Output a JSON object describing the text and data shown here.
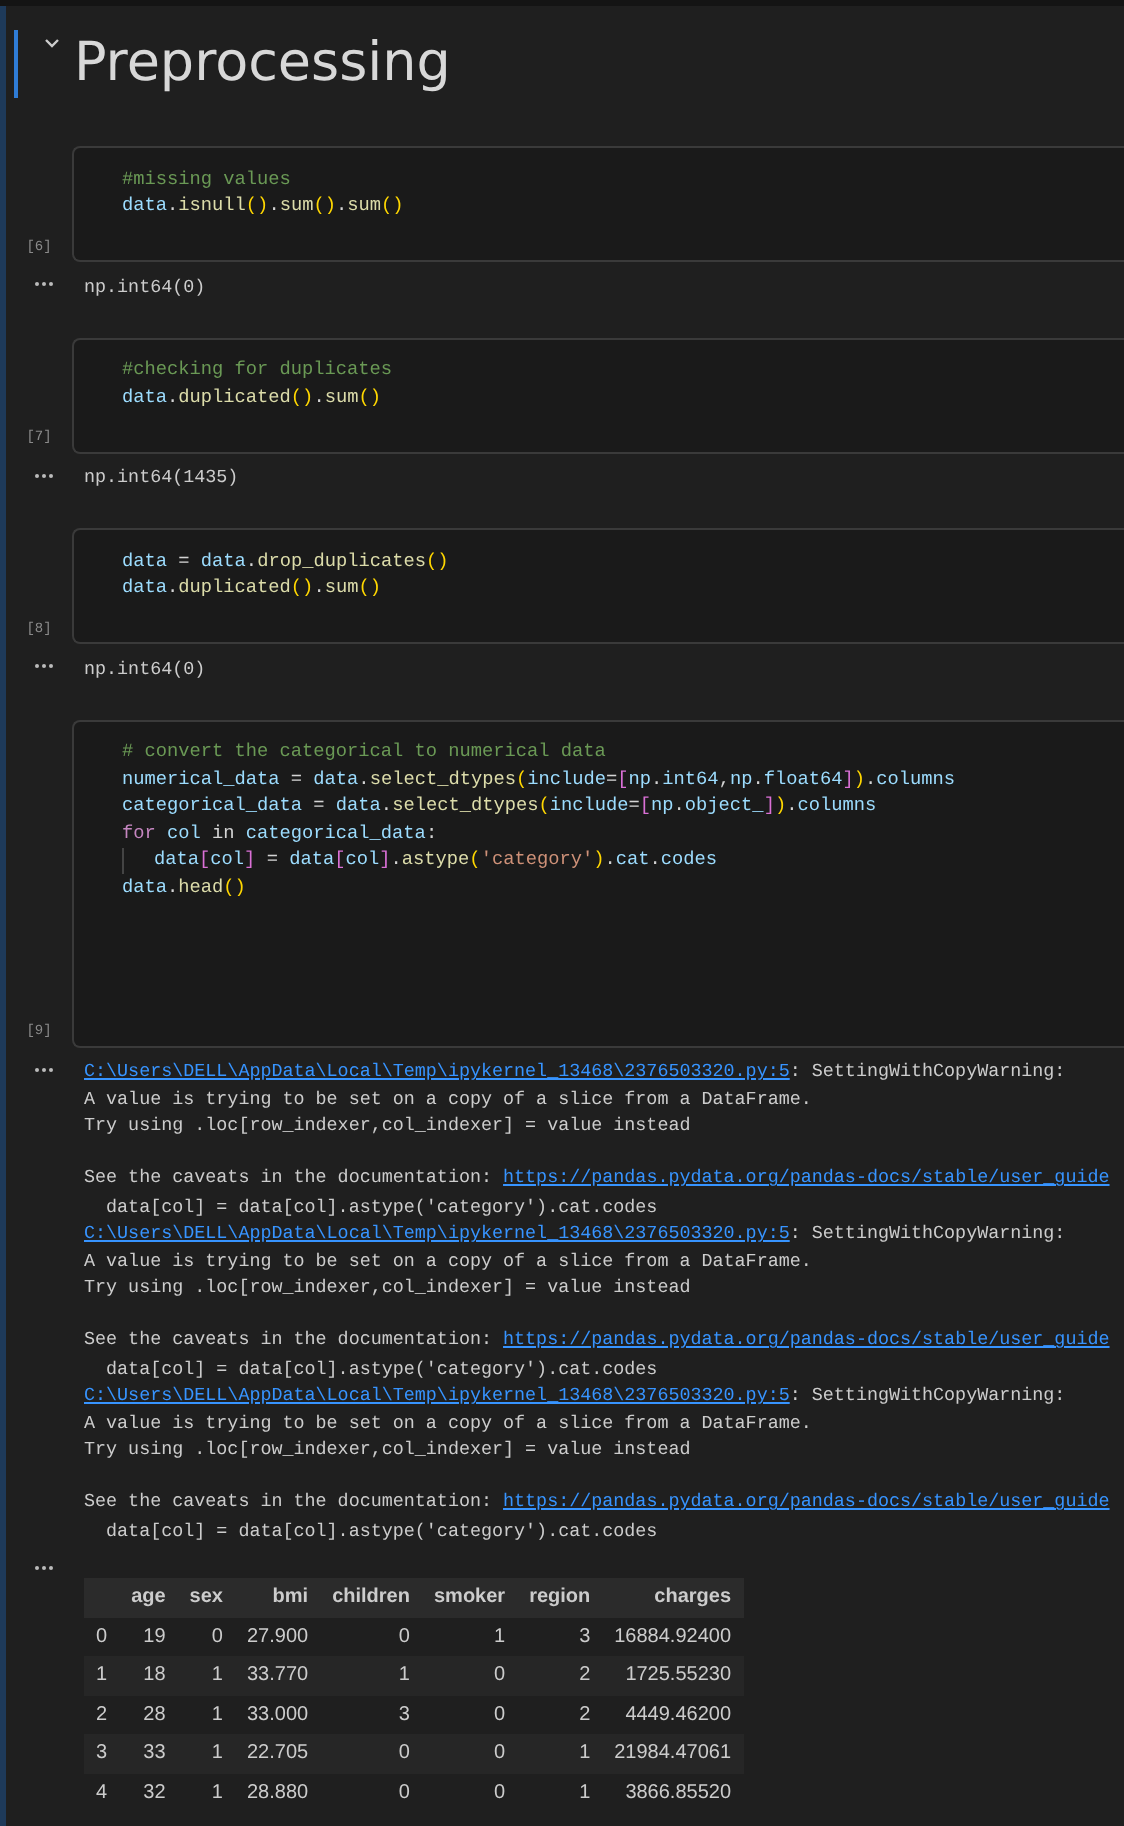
{
  "heading": {
    "title": "Preprocessing",
    "expanded": true,
    "selected": true
  },
  "cells": [
    {
      "count": "[6]",
      "lines": [
        {
          "segments": [
            {
              "kind": "comment",
              "text": "#missing values"
            }
          ]
        },
        {
          "segments": [
            {
              "kind": "var",
              "text": "data"
            },
            {
              "kind": "plain",
              "text": "."
            },
            {
              "kind": "func",
              "text": "isnull"
            },
            {
              "kind": "paren",
              "text": "()"
            },
            {
              "kind": "plain",
              "text": "."
            },
            {
              "kind": "func",
              "text": "sum"
            },
            {
              "kind": "paren",
              "text": "()"
            },
            {
              "kind": "plain",
              "text": "."
            },
            {
              "kind": "func",
              "text": "sum"
            },
            {
              "kind": "paren",
              "text": "()"
            }
          ]
        }
      ],
      "outputs": [
        {
          "kind": "text",
          "lines": [
            {
              "segments": [
                {
                  "kind": "plain",
                  "text": "np.int64(0)"
                }
              ]
            }
          ]
        }
      ]
    },
    {
      "count": "[7]",
      "lines": [
        {
          "segments": [
            {
              "kind": "comment",
              "text": "#checking for duplicates"
            }
          ]
        },
        {
          "segments": [
            {
              "kind": "var",
              "text": "data"
            },
            {
              "kind": "plain",
              "text": "."
            },
            {
              "kind": "func",
              "text": "duplicated"
            },
            {
              "kind": "paren",
              "text": "()"
            },
            {
              "kind": "plain",
              "text": "."
            },
            {
              "kind": "func",
              "text": "sum"
            },
            {
              "kind": "paren",
              "text": "()"
            }
          ]
        }
      ],
      "outputs": [
        {
          "kind": "text",
          "lines": [
            {
              "segments": [
                {
                  "kind": "plain",
                  "text": "np.int64(1435)"
                }
              ]
            }
          ]
        }
      ]
    },
    {
      "count": "[8]",
      "lines": [
        {
          "segments": [
            {
              "kind": "var",
              "text": "data"
            },
            {
              "kind": "plain",
              "text": " = "
            },
            {
              "kind": "var",
              "text": "data"
            },
            {
              "kind": "plain",
              "text": "."
            },
            {
              "kind": "func",
              "text": "drop_duplicates"
            },
            {
              "kind": "paren",
              "text": "()"
            }
          ]
        },
        {
          "segments": [
            {
              "kind": "var",
              "text": "data"
            },
            {
              "kind": "plain",
              "text": "."
            },
            {
              "kind": "func",
              "text": "duplicated"
            },
            {
              "kind": "paren",
              "text": "()"
            },
            {
              "kind": "plain",
              "text": "."
            },
            {
              "kind": "func",
              "text": "sum"
            },
            {
              "kind": "paren",
              "text": "()"
            }
          ]
        }
      ],
      "outputs": [
        {
          "kind": "text",
          "lines": [
            {
              "segments": [
                {
                  "kind": "plain",
                  "text": "np.int64(0)"
                }
              ]
            }
          ]
        }
      ]
    },
    {
      "count": "[9]",
      "lines": [
        {
          "segments": [
            {
              "kind": "comment",
              "text": "# convert the categorical to numerical data"
            }
          ]
        },
        {
          "segments": [
            {
              "kind": "var",
              "text": "numerical_data"
            },
            {
              "kind": "plain",
              "text": " = "
            },
            {
              "kind": "var",
              "text": "data"
            },
            {
              "kind": "plain",
              "text": "."
            },
            {
              "kind": "func",
              "text": "select_dtypes"
            },
            {
              "kind": "paren",
              "text": "("
            },
            {
              "kind": "var",
              "text": "include"
            },
            {
              "kind": "plain",
              "text": "="
            },
            {
              "kind": "bracket",
              "text": "["
            },
            {
              "kind": "var",
              "text": "np"
            },
            {
              "kind": "plain",
              "text": "."
            },
            {
              "kind": "var",
              "text": "int64"
            },
            {
              "kind": "plain",
              "text": ","
            },
            {
              "kind": "var",
              "text": "np"
            },
            {
              "kind": "plain",
              "text": "."
            },
            {
              "kind": "var",
              "text": "float64"
            },
            {
              "kind": "bracket",
              "text": "]"
            },
            {
              "kind": "paren",
              "text": ")"
            },
            {
              "kind": "plain",
              "text": "."
            },
            {
              "kind": "var",
              "text": "columns"
            }
          ]
        },
        {
          "segments": [
            {
              "kind": "var",
              "text": "categorical_data"
            },
            {
              "kind": "plain",
              "text": " = "
            },
            {
              "kind": "var",
              "text": "data"
            },
            {
              "kind": "plain",
              "text": "."
            },
            {
              "kind": "func",
              "text": "select_dtypes"
            },
            {
              "kind": "paren",
              "text": "("
            },
            {
              "kind": "var",
              "text": "include"
            },
            {
              "kind": "plain",
              "text": "="
            },
            {
              "kind": "bracket",
              "text": "["
            },
            {
              "kind": "var",
              "text": "np"
            },
            {
              "kind": "plain",
              "text": "."
            },
            {
              "kind": "var",
              "text": "object_"
            },
            {
              "kind": "bracket",
              "text": "]"
            },
            {
              "kind": "paren",
              "text": ")"
            },
            {
              "kind": "plain",
              "text": "."
            },
            {
              "kind": "var",
              "text": "columns"
            }
          ]
        },
        {
          "segments": [
            {
              "kind": "keyword",
              "text": "for"
            },
            {
              "kind": "var",
              "text": " col"
            },
            {
              "kind": "plain",
              "text": " in "
            },
            {
              "kind": "var",
              "text": "categorical_data"
            },
            {
              "kind": "plain",
              "text": ":"
            }
          ]
        },
        {
          "indented": true,
          "segments": [
            {
              "kind": "var",
              "text": "data"
            },
            {
              "kind": "bracket",
              "text": "["
            },
            {
              "kind": "var",
              "text": "col"
            },
            {
              "kind": "bracket",
              "text": "]"
            },
            {
              "kind": "plain",
              "text": " = "
            },
            {
              "kind": "var",
              "text": "data"
            },
            {
              "kind": "bracket",
              "text": "["
            },
            {
              "kind": "var",
              "text": "col"
            },
            {
              "kind": "bracket",
              "text": "]"
            },
            {
              "kind": "plain",
              "text": "."
            },
            {
              "kind": "func",
              "text": "astype"
            },
            {
              "kind": "paren",
              "text": "("
            },
            {
              "kind": "string",
              "text": "'category'"
            },
            {
              "kind": "paren",
              "text": ")"
            },
            {
              "kind": "plain",
              "text": "."
            },
            {
              "kind": "var",
              "text": "cat"
            },
            {
              "kind": "plain",
              "text": "."
            },
            {
              "kind": "var",
              "text": "codes"
            }
          ]
        },
        {
          "segments": [
            {
              "kind": "var",
              "text": "data"
            },
            {
              "kind": "plain",
              "text": "."
            },
            {
              "kind": "func",
              "text": "head"
            },
            {
              "kind": "paren",
              "text": "()"
            }
          ]
        }
      ],
      "outputs": [
        {
          "kind": "text",
          "lines": [
            {
              "segments": [
                {
                  "kind": "link",
                  "text": "C:\\Users\\DELL\\AppData\\Local\\Temp\\ipykernel_13468\\2376503320.py:5"
                },
                {
                  "kind": "plain",
                  "text": ": SettingWithCopyWarning:"
                }
              ]
            },
            {
              "segments": [
                {
                  "kind": "plain",
                  "text": "A value is trying to be set on a copy of a slice from a DataFrame."
                }
              ]
            },
            {
              "segments": [
                {
                  "kind": "plain",
                  "text": "Try using .loc[row_indexer,col_indexer] = value instead"
                }
              ]
            },
            {
              "gap_before": true,
              "segments": [
                {
                  "kind": "plain",
                  "text": "See the caveats in the documentation: "
                },
                {
                  "kind": "link",
                  "text": "https://pandas.pydata.org/pandas-docs/stable/user_guide"
                }
              ]
            },
            {
              "segments": [
                {
                  "kind": "plain",
                  "text": "  data[col] = data[col].astype('category').cat.codes"
                }
              ]
            },
            {
              "segments": [
                {
                  "kind": "link",
                  "text": "C:\\Users\\DELL\\AppData\\Local\\Temp\\ipykernel_13468\\2376503320.py:5"
                },
                {
                  "kind": "plain",
                  "text": ": SettingWithCopyWarning:"
                }
              ]
            },
            {
              "segments": [
                {
                  "kind": "plain",
                  "text": "A value is trying to be set on a copy of a slice from a DataFrame."
                }
              ]
            },
            {
              "segments": [
                {
                  "kind": "plain",
                  "text": "Try using .loc[row_indexer,col_indexer] = value instead"
                }
              ]
            },
            {
              "gap_before": true,
              "segments": [
                {
                  "kind": "plain",
                  "text": "See the caveats in the documentation: "
                },
                {
                  "kind": "link",
                  "text": "https://pandas.pydata.org/pandas-docs/stable/user_guide"
                }
              ]
            },
            {
              "segments": [
                {
                  "kind": "plain",
                  "text": "  data[col] = data[col].astype('category').cat.codes"
                }
              ]
            },
            {
              "segments": [
                {
                  "kind": "link",
                  "text": "C:\\Users\\DELL\\AppData\\Local\\Temp\\ipykernel_13468\\2376503320.py:5"
                },
                {
                  "kind": "plain",
                  "text": ": SettingWithCopyWarning:"
                }
              ]
            },
            {
              "segments": [
                {
                  "kind": "plain",
                  "text": "A value is trying to be set on a copy of a slice from a DataFrame."
                }
              ]
            },
            {
              "segments": [
                {
                  "kind": "plain",
                  "text": "Try using .loc[row_indexer,col_indexer] = value instead"
                }
              ]
            },
            {
              "gap_before": true,
              "segments": [
                {
                  "kind": "plain",
                  "text": "See the caveats in the documentation: "
                },
                {
                  "kind": "link",
                  "text": "https://pandas.pydata.org/pandas-docs/stable/user_guide"
                }
              ]
            },
            {
              "segments": [
                {
                  "kind": "plain",
                  "text": "  data[col] = data[col].astype('category').cat.codes"
                }
              ]
            }
          ]
        },
        {
          "kind": "table",
          "columns": [
            "",
            "age",
            "sex",
            "bmi",
            "children",
            "smoker",
            "region",
            "charges"
          ],
          "rows": [
            [
              "0",
              "19",
              "0",
              "27.900",
              "0",
              "1",
              "3",
              "16884.92400"
            ],
            [
              "1",
              "18",
              "1",
              "33.770",
              "1",
              "0",
              "2",
              "1725.55230"
            ],
            [
              "2",
              "28",
              "1",
              "33.000",
              "3",
              "0",
              "2",
              "4449.46200"
            ],
            [
              "3",
              "33",
              "1",
              "22.705",
              "0",
              "0",
              "1",
              "21984.47061"
            ],
            [
              "4",
              "32",
              "1",
              "28.880",
              "0",
              "0",
              "1",
              "3866.85520"
            ]
          ]
        }
      ]
    }
  ]
}
